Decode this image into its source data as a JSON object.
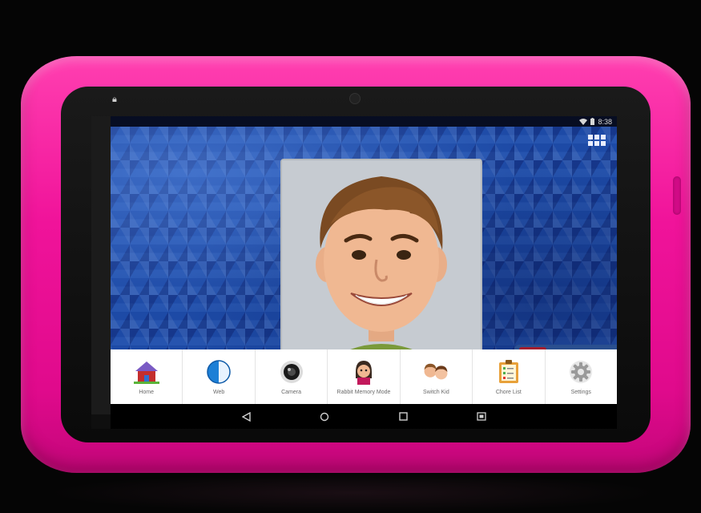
{
  "device": {
    "bumper_color": "#f0139a",
    "status_bar": {
      "time": "8:38",
      "icons": [
        "wifi-icon",
        "battery-icon"
      ]
    },
    "lock_indicator_icon": "lock-icon"
  },
  "home_screen": {
    "wallpaper_color": "#1d4aa6",
    "app_grid_icon": "app-grid-icon",
    "avatar": "kid-avatar-image"
  },
  "dock": {
    "items": [
      {
        "label": "Home",
        "icon": "home-icon"
      },
      {
        "label": "Web",
        "icon": "web-icon"
      },
      {
        "label": "Camera",
        "icon": "camera-icon"
      },
      {
        "label": "Rabbit Memory Mode",
        "icon": "memory-mode-icon"
      },
      {
        "label": "Switch Kid",
        "icon": "switch-kid-icon"
      },
      {
        "label": "Chore List",
        "icon": "chore-list-icon"
      },
      {
        "label": "Settings",
        "icon": "settings-icon"
      }
    ]
  },
  "nav_bar": {
    "buttons": [
      "back-icon",
      "home-nav-icon",
      "recents-icon",
      "screenshot-icon"
    ]
  }
}
